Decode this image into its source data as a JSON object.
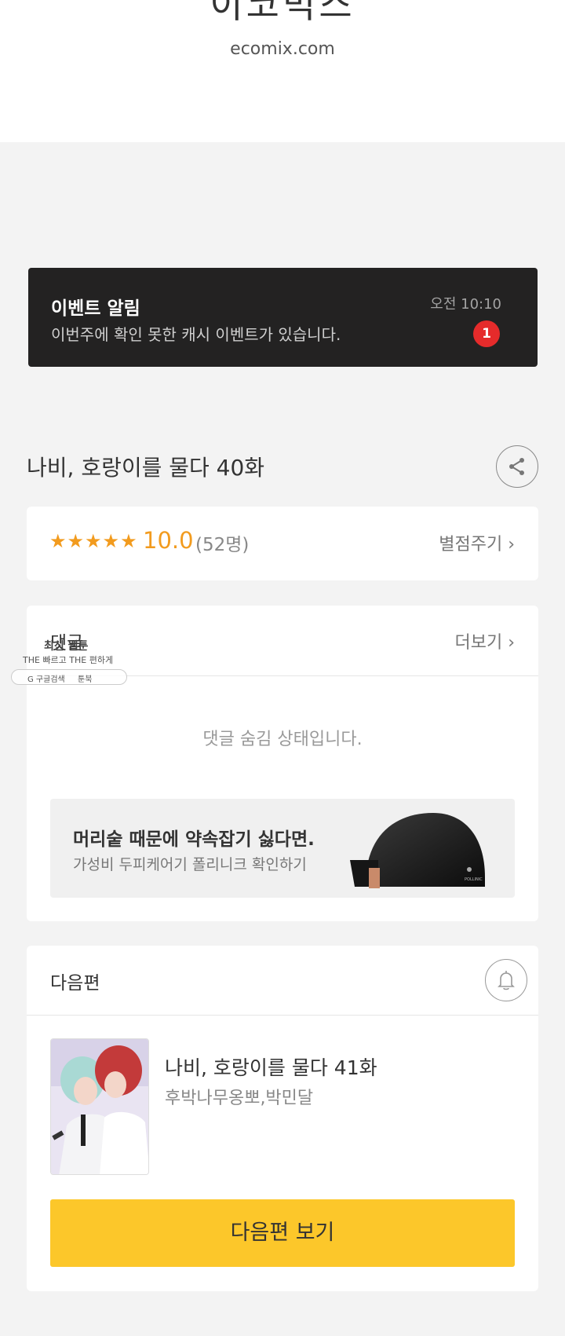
{
  "header": {
    "logo_text": "이코믹스",
    "site_url": "ecomix.com"
  },
  "notice": {
    "title": "이벤트 알림",
    "text": "이번주에 확인 못한 캐시 이벤트가 있습니다.",
    "time": "오전 10:10",
    "badge_count": "1"
  },
  "episode": {
    "title": "나비, 호랑이를 물다 40화"
  },
  "rating": {
    "stars": "★★★★★",
    "score": "10.0",
    "count": "(52명)",
    "rate_link": "별점주기 ›",
    "star_color": "#f29b1e"
  },
  "comments": {
    "heading": "댓글",
    "more_link": "더보기 ›",
    "hidden_message": "댓글 숨김 상태입니다."
  },
  "ad": {
    "title": "머리숱 때문에 약속잡기 싫다면.",
    "subtitle": "가성비 두피케어기 폴리니크 확인하기",
    "brand_mark": "POLLINIC"
  },
  "overlay": {
    "line1": "최신 웹툰",
    "line2": "THE 빠르고 THE 편하게",
    "pill_left": "G 구글검색",
    "pill_right": "툰북"
  },
  "next_episode": {
    "heading": "다음편",
    "title": "나비, 호랑이를 물다 41화",
    "authors": "후박나무옹뽀,박민달",
    "button_label": "다음편 보기",
    "button_color": "#fcc72a"
  }
}
